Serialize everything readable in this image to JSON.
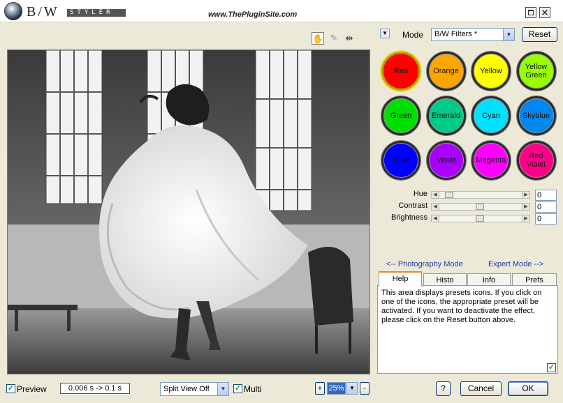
{
  "window": {
    "brand_primary": "B/W",
    "brand_secondary": "STYLER",
    "site_url": "www.ThePluginSite.com"
  },
  "tools": [
    {
      "name": "hand-tool",
      "glyph": "✋"
    },
    {
      "name": "eyedropper-tool",
      "glyph": "✎"
    },
    {
      "name": "split-tool",
      "glyph": "⇹"
    }
  ],
  "mode": {
    "label": "Mode",
    "value": "B/W Filters *",
    "reset_label": "Reset"
  },
  "presets": [
    {
      "label": "Red",
      "color": "#ff0000"
    },
    {
      "label": "Orange",
      "color": "#ffa500"
    },
    {
      "label": "Yellow",
      "color": "#ffff00"
    },
    {
      "label": "Yellow Green",
      "color": "#99ff00"
    },
    {
      "label": "Green",
      "color": "#00e000"
    },
    {
      "label": "Emerald",
      "color": "#00cc88"
    },
    {
      "label": "Cyan",
      "color": "#00e0ff"
    },
    {
      "label": "Skyblue",
      "color": "#0088ee"
    },
    {
      "label": "Blue",
      "color": "#0000ff"
    },
    {
      "label": "Violet",
      "color": "#aa00ff"
    },
    {
      "label": "Magenta",
      "color": "#ff00ff"
    },
    {
      "label": "Red Violet",
      "color": "#ff0088"
    }
  ],
  "active_preset": "Red",
  "sliders": [
    {
      "label": "Hue",
      "value": "0",
      "position": 0.07
    },
    {
      "label": "Contrast",
      "value": "0",
      "position": 0.5
    },
    {
      "label": "Brightness",
      "value": "0",
      "position": 0.5
    }
  ],
  "links": {
    "photography": "<-- Photography Mode",
    "expert": "Expert Mode -->"
  },
  "tabs": [
    {
      "label": "Help",
      "active": true
    },
    {
      "label": "Histo",
      "active": false
    },
    {
      "label": "Info",
      "active": false
    },
    {
      "label": "Prefs",
      "active": false
    }
  ],
  "help_text": "This area displays presets icons. If you click on one of the icons, the appropriate preset will be activated. If you want to deactivate the effect, please click on the Reset button above.",
  "bottom": {
    "preview_label": "Preview",
    "render_time": "0.006 s -> 0.1 s",
    "split_view": "Split View Off",
    "multi_label": "Multi",
    "zoom_in": "+",
    "zoom_value": "25%",
    "zoom_out": "-",
    "help_label": "?",
    "cancel_label": "Cancel",
    "ok_label": "OK"
  }
}
